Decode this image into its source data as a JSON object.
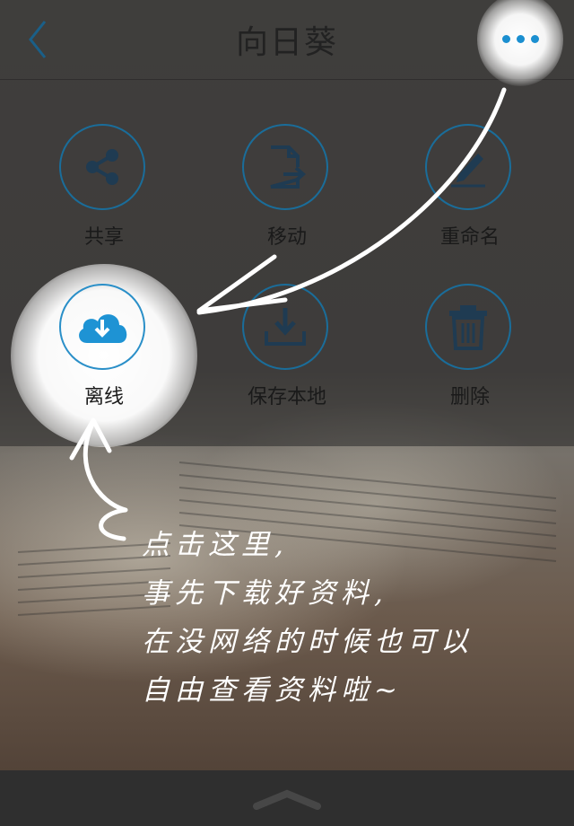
{
  "header": {
    "title": "向日葵",
    "back_icon": "chevron-left-icon",
    "more_icon": "more-dots-icon"
  },
  "actions": [
    {
      "label": "共享",
      "icon": "share-icon"
    },
    {
      "label": "移动",
      "icon": "move-file-icon"
    },
    {
      "label": "重命名",
      "icon": "rename-pencil-icon"
    },
    {
      "label": "离线",
      "icon": "cloud-download-icon"
    },
    {
      "label": "保存本地",
      "icon": "save-local-icon"
    },
    {
      "label": "删除",
      "icon": "trash-icon"
    }
  ],
  "tip": {
    "lines": [
      "点击这里,",
      "事先下载好资料,",
      "在没网络的时候也可以",
      "自由查看资料啦~"
    ]
  },
  "bottom": {
    "handle_icon": "chevron-up-icon"
  },
  "colors": {
    "accent": "#1b8fd0",
    "ring": "#1a6d9a",
    "overlay": "#282828"
  }
}
